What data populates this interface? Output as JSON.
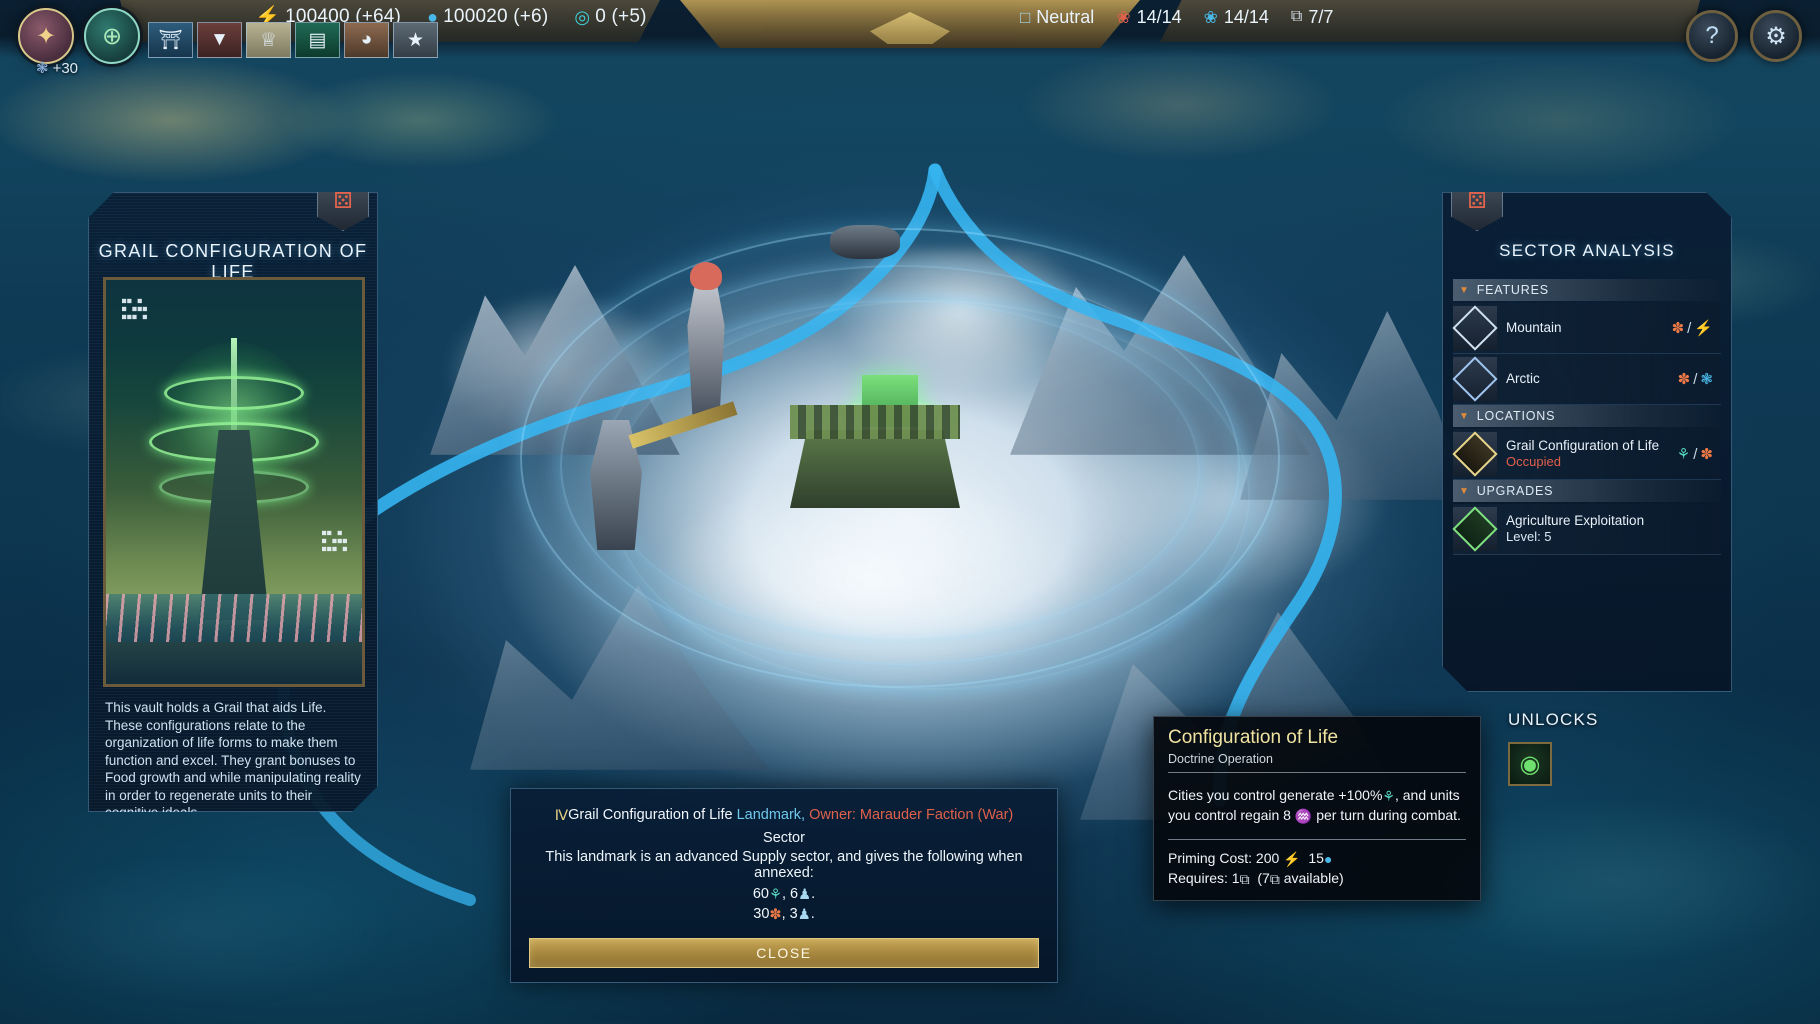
{
  "topbar": {
    "resources": [
      {
        "icon": "energy-icon",
        "glyph": "⚡",
        "cls": "c-energy",
        "value": "100400 (+64)"
      },
      {
        "icon": "mana-icon",
        "glyph": "●",
        "cls": "c-mana",
        "value": "100020 (+6)"
      },
      {
        "icon": "knowledge-icon",
        "glyph": "◎",
        "cls": "c-know",
        "value": "0 (+5)"
      }
    ],
    "status": [
      {
        "icon": "diplomacy-face-icon",
        "glyph": "□",
        "cls": "c-pop",
        "value": "Neutral"
      },
      {
        "icon": "imperium-red-icon",
        "glyph": "❀",
        "cls": "c-red",
        "value": "14/14"
      },
      {
        "icon": "imperium-blue-icon",
        "glyph": "❀",
        "cls": "c-mana",
        "value": "14/14"
      },
      {
        "icon": "draft-icon",
        "glyph": "⧉",
        "cls": "c-draft",
        "value": "7/7"
      }
    ],
    "orbs": [
      {
        "name": "faction-orb-pink",
        "glyph": "✦"
      },
      {
        "name": "faction-orb-green",
        "glyph": "⊕"
      }
    ],
    "orb_badge": {
      "icon": "research-icon",
      "glyph": "❃",
      "value": "+30"
    },
    "tabs": [
      {
        "name": "tab-government",
        "glyph": "⛩"
      },
      {
        "name": "tab-society",
        "glyph": "▼"
      },
      {
        "name": "tab-victory",
        "glyph": "♕"
      },
      {
        "name": "tab-cities",
        "glyph": "▤"
      },
      {
        "name": "tab-units",
        "glyph": "◕"
      },
      {
        "name": "tab-stars",
        "glyph": "★"
      }
    ],
    "right_buttons": [
      {
        "name": "help-button",
        "glyph": "?"
      },
      {
        "name": "settings-button",
        "glyph": "⚙"
      }
    ]
  },
  "left_panel": {
    "title": "GRAIL CONFIGURATION OF LIFE",
    "crest_icon": "marauder-crest-icon",
    "art_code_top": "▄▄ ▄\n▄ ▄▄▄\n▄▄▄ ▄",
    "art_code_bottom": "▄▄ ▄\n▄ ▄▄▄\n▄▄▄ ▄",
    "description": "This vault holds a Grail that aids Life. These configurations relate to the organization of life forms to make them function and excel. They grant bonuses to Food growth and while manipulating reality in order to regenerate units to their cognitive ideals."
  },
  "right_panel": {
    "title": "SECTOR ANALYSIS",
    "crest_icon": "marauder-crest-icon",
    "sections": [
      {
        "header": "FEATURES",
        "rows": [
          {
            "icon": "mountain-icon",
            "glyph": "◢",
            "icon_style": "plain",
            "name": "Mountain",
            "sub": "",
            "right": [
              {
                "glyph": "✽",
                "cls": "c-prod"
              },
              {
                "glyph": "/",
                "cls": "sep"
              },
              {
                "glyph": "⚡",
                "cls": "c-energy"
              }
            ]
          },
          {
            "icon": "arctic-snowflake-icon",
            "glyph": "❄",
            "icon_style": "snow",
            "name": "Arctic",
            "sub": "",
            "right": [
              {
                "glyph": "✽",
                "cls": "c-prod"
              },
              {
                "glyph": "/",
                "cls": "sep"
              },
              {
                "glyph": "❃",
                "cls": "c-mana"
              }
            ]
          }
        ]
      },
      {
        "header": "LOCATIONS",
        "rows": [
          {
            "icon": "landmark-pillar-icon",
            "glyph": "Ⅳ",
            "icon_style": "gold",
            "name": "Grail Configuration of Life",
            "sub": "Occupied",
            "right": [
              {
                "glyph": "⚘",
                "cls": "c-food"
              },
              {
                "glyph": "/",
                "cls": "sep"
              },
              {
                "glyph": "✽",
                "cls": "c-prod"
              }
            ]
          }
        ]
      },
      {
        "header": "UPGRADES",
        "rows": [
          {
            "icon": "agriculture-leaf-icon",
            "glyph": "⚘",
            "icon_style": "green",
            "name": "Agriculture Exploitation",
            "lvl": "Level: 5",
            "right": []
          }
        ]
      }
    ]
  },
  "unlocks": {
    "title": "UNLOCKS",
    "icon_name": "configuration-of-life-unlock-icon",
    "icon_glyph": "◉"
  },
  "tooltip": {
    "title": "Configuration of Life",
    "subtitle": "Doctrine Operation",
    "body_prefix": "Cities you control generate +100%",
    "body_food_icon": "⚘",
    "body_mid": ", and units you control regain 8",
    "body_hp_icon": "♒",
    "body_suffix": "per turn during combat.",
    "priming_label": "Priming Cost: 200",
    "priming_energy_icon": "⚡",
    "priming_mana_value": "15",
    "priming_mana_icon": "●",
    "requires_label": "Requires: 1",
    "requires_icon": "⧉",
    "requires_avail": "(7",
    "requires_avail_suffix": "available)"
  },
  "bottom_dialog": {
    "landmark_icon": "Ⅳ",
    "landmark_name": "Grail Configuration of Life",
    "landmark_tag": "Landmark,",
    "owner": "Owner: Marauder Faction (War)",
    "sector_label": "Sector",
    "description": "This landmark is an advanced Supply sector, and gives the following when annexed:",
    "stats": [
      {
        "value": "60",
        "icon": "⚘",
        "cls": "c-food",
        "value2": "6",
        "icon2": "♟",
        "cls2": "c-pop"
      },
      {
        "value": "30",
        "icon": "✽",
        "cls": "c-prod",
        "value2": "3",
        "icon2": "♟",
        "cls2": "c-pop"
      }
    ],
    "close_label": "CLOSE"
  }
}
